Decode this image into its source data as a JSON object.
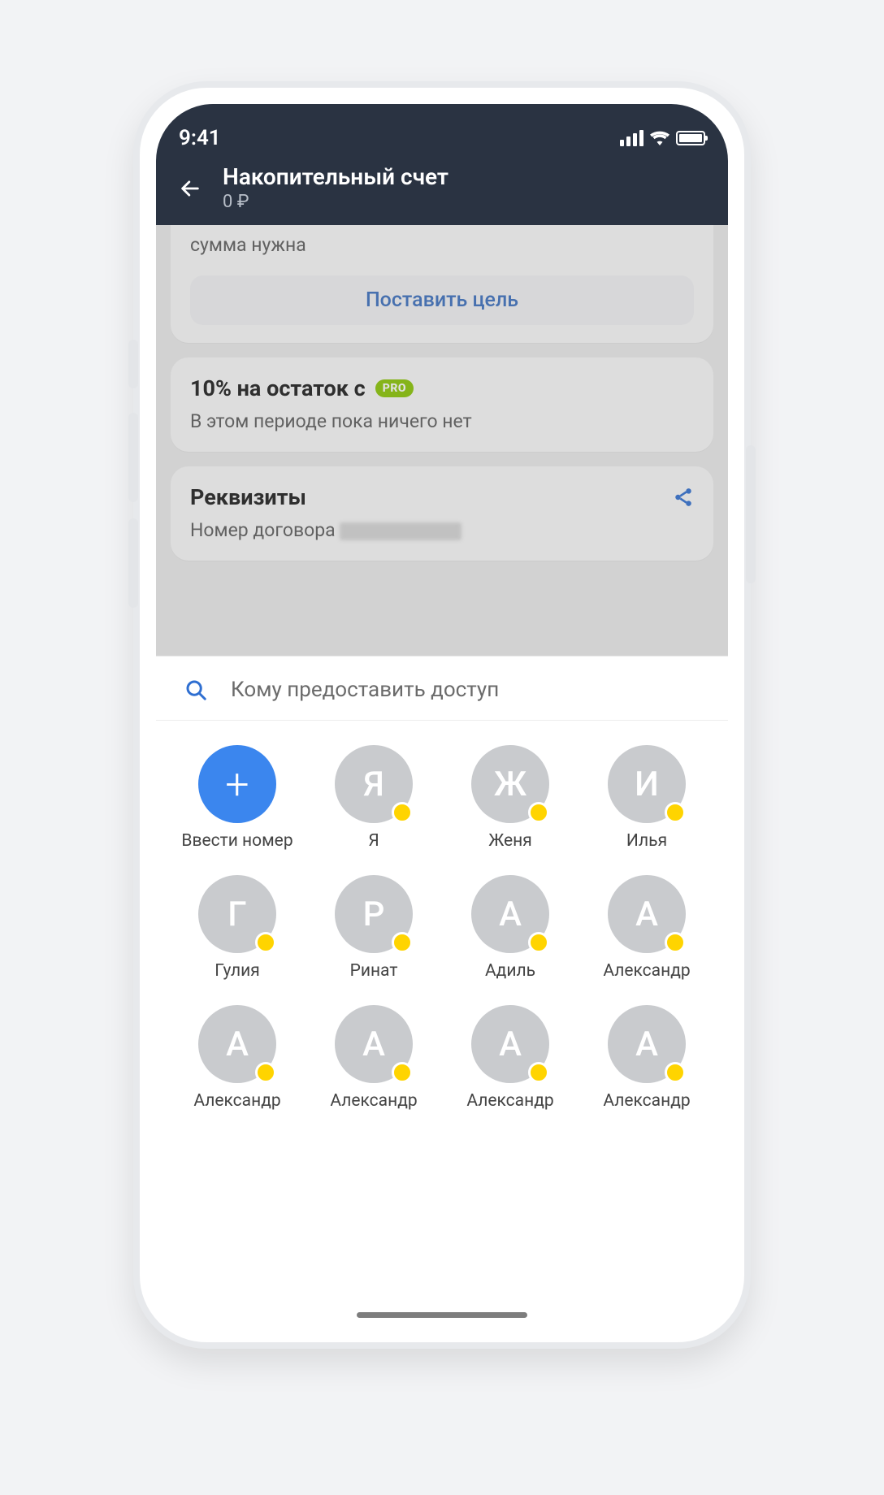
{
  "status": {
    "time": "9:41"
  },
  "nav": {
    "title": "Накопительный счет",
    "subtitle": "0 ₽"
  },
  "bg": {
    "goal_hint": "сумма нужна",
    "goal_button": "Поставить цель",
    "promo_title": "10% на остаток с",
    "promo_badge": "PRO",
    "promo_sub": "В этом периоде пока ничего нет",
    "req_title": "Реквизиты",
    "req_row": "Номер договора"
  },
  "sheet": {
    "search_placeholder": "Кому предоставить доступ",
    "add_label": "Ввести номер",
    "contacts": [
      {
        "initial": "Я",
        "name": "Я"
      },
      {
        "initial": "Ж",
        "name": "Женя"
      },
      {
        "initial": "И",
        "name": "Илья"
      },
      {
        "initial": "Г",
        "name": "Гулия"
      },
      {
        "initial": "Р",
        "name": "Ринат"
      },
      {
        "initial": "А",
        "name": "Адиль"
      },
      {
        "initial": "А",
        "name": "Александр"
      },
      {
        "initial": "А",
        "name": "Александр"
      },
      {
        "initial": "А",
        "name": "Александр"
      },
      {
        "initial": "А",
        "name": "Александр"
      },
      {
        "initial": "А",
        "name": "Александр"
      }
    ]
  }
}
